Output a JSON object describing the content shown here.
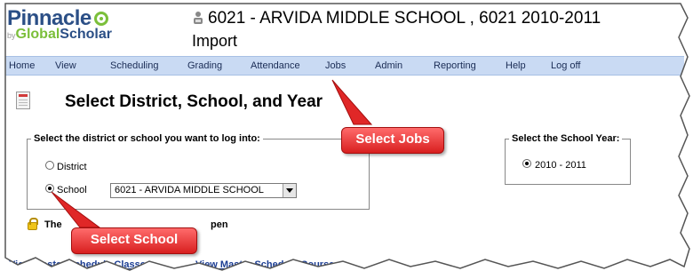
{
  "header": {
    "logo_brand": "Pinnacle",
    "logo_by": "by",
    "logo_sub_a": "Global",
    "logo_sub_b": "Scholar",
    "school_title": "6021 - ARVIDA MIDDLE SCHOOL , 6021 2010-2011",
    "import_title": "Import"
  },
  "nav": {
    "items": [
      "Home",
      "View",
      "Scheduling",
      "Grading",
      "Attendance",
      "Jobs",
      "Admin",
      "Reporting",
      "Help",
      "Log off"
    ]
  },
  "page": {
    "heading": "Select District, School, and Year",
    "district_legend": "Select the district or school you want to log into:",
    "district_label": "District",
    "school_label": "School",
    "school_selected": "6021 - ARVIDA MIDDLE SCHOOL",
    "year_legend": "Select the School Year:",
    "year_value": "2010 - 2011",
    "notice_start": "The",
    "notice_end": "pen",
    "link_master_sched": "View Master Schedule Classes",
    "link_master_courses": "View Master Schedule Courses"
  },
  "callouts": {
    "jobs": "Select Jobs",
    "school": "Select School"
  },
  "colors": {
    "nav_bg": "#c9daf3",
    "callout_red": "#d81f1f",
    "link_blue": "#1c3e94",
    "brand_blue": "#2b4f86",
    "brand_green": "#7bbf3a"
  }
}
